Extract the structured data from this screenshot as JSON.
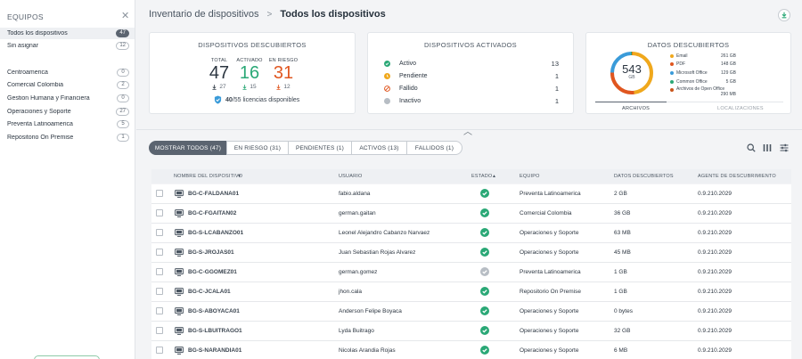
{
  "sidebar": {
    "title": "EQUIPOS",
    "items": [
      {
        "label": "Todos los dispositivos",
        "count": "47",
        "active": true
      },
      {
        "label": "Sin asignar",
        "count": "12"
      },
      {
        "label": "Centroamerica",
        "count": "0"
      },
      {
        "label": "Comercial Colombia",
        "count": "2"
      },
      {
        "label": "Gestion Humana y Financiera",
        "count": "0"
      },
      {
        "label": "Operaciones y Soporte",
        "count": "27"
      },
      {
        "label": "Preventa Latinoamerica",
        "count": "5"
      },
      {
        "label": "Repositorio On Premise",
        "count": "1"
      }
    ]
  },
  "header": {
    "breadcrumb_root": "Inventario de dispositivos",
    "breadcrumb_current": "Todos los dispositivos"
  },
  "discovered": {
    "title": "DISPOSITIVOS DESCUBIERTOS",
    "total_label": "TOTAL",
    "total": "47",
    "total_sub": "27",
    "active_label": "ACTIVADO",
    "active": "16",
    "active_sub": "15",
    "risk_label": "EN RIESGO",
    "risk": "31",
    "risk_sub": "12",
    "licenses_count": "40",
    "licenses_text": "/55 licencias disponibles",
    "colors": {
      "total": "#2b3540",
      "active": "#2aa876",
      "risk": "#e0561f"
    }
  },
  "activated": {
    "title": "DISPOSITIVOS ACTIVADOS",
    "rows": [
      {
        "label": "Activo",
        "count": "13",
        "status": "active",
        "color": "#2aa876"
      },
      {
        "label": "Pendiente",
        "count": "1",
        "status": "pending",
        "color": "#f0a81c"
      },
      {
        "label": "Fallido",
        "count": "1",
        "status": "failed",
        "color": "#e0561f"
      },
      {
        "label": "Inactivo",
        "count": "1",
        "status": "inactive",
        "color": "#b7bdc4"
      }
    ]
  },
  "data_discovered": {
    "title": "DATOS DESCUBIERTOS",
    "total_value": "543",
    "total_unit": "GB",
    "legend": [
      {
        "label": "Email",
        "size": "261 GB",
        "color": "#f0a81c"
      },
      {
        "label": "PDF",
        "size": "148 GB",
        "color": "#e0561f"
      },
      {
        "label": "Microsoft Office",
        "size": "129 GB",
        "color": "#3a9bd9"
      },
      {
        "label": "Common Office",
        "size": "5 GB",
        "color": "#2aa876"
      },
      {
        "label": "Archivos de Open Office",
        "size": "290 MB",
        "color": "#c9551a"
      }
    ],
    "tabs": [
      "ARCHIVOS",
      "LOCALIZACIONES"
    ]
  },
  "filters": [
    {
      "label": "MOSTRAR TODOS (47)"
    },
    {
      "label": "EN RIESGO (31)"
    },
    {
      "label": "PENDIENTES (1)"
    },
    {
      "label": "ACTIVOS (13)"
    },
    {
      "label": "FALLIDOS (1)"
    }
  ],
  "table": {
    "headers": {
      "device": "NOMBRE DEL DISPOSITIVO",
      "user": "USUARIO",
      "status": "ESTADO",
      "team": "EQUIPO",
      "data": "DATOS DESCUBIERTOS",
      "agent": "AGENTE DE DESCUBRIMIENTO"
    },
    "rows": [
      {
        "device": "BG-C-FALDANA01",
        "user": "fabio.aldana",
        "status": "active",
        "team": "Preventa Latinoamerica",
        "data": "2 GB",
        "agent": "0.9.210.2029"
      },
      {
        "device": "BG-C-FGAITAN02",
        "user": "german.gaitan",
        "status": "active",
        "team": "Comercial Colombia",
        "data": "36 GB",
        "agent": "0.9.210.2029"
      },
      {
        "device": "BG-S-LCABANZO01",
        "user": "Leonel Alejandro Cabanzo Narvaez",
        "status": "active",
        "team": "Operaciones y Soporte",
        "data": "63 MB",
        "agent": "0.9.210.2029"
      },
      {
        "device": "BG-S-JROJAS01",
        "user": "Juan Sebastian Rojas Alvarez",
        "status": "active",
        "team": "Operaciones y Soporte",
        "data": "45 MB",
        "agent": "0.9.210.2029"
      },
      {
        "device": "BG-C-GGOMEZ01",
        "user": "german.gomez",
        "status": "inactive",
        "team": "Preventa Latinoamerica",
        "data": "1 GB",
        "agent": "0.9.210.2029"
      },
      {
        "device": "BG-C-JCALA01",
        "user": "jhon.cala",
        "status": "active",
        "team": "Repositorio On Premise",
        "data": "1 GB",
        "agent": "0.9.210.2029"
      },
      {
        "device": "BG-S-ABOYACA01",
        "user": "Anderson Felipe Boyaca",
        "status": "active",
        "team": "Operaciones y Soporte",
        "data": "0 bytes",
        "agent": "0.9.210.2029"
      },
      {
        "device": "BG-S-LBUITRAGO1",
        "user": "Lyda Buitrago",
        "status": "active",
        "team": "Operaciones y Soporte",
        "data": "32 GB",
        "agent": "0.9.210.2029"
      },
      {
        "device": "BG-S-NARANDIA01",
        "user": "Nicolas Arandia Rojas",
        "status": "active",
        "team": "Operaciones y Soporte",
        "data": "6 MB",
        "agent": "0.9.210.2029"
      }
    ]
  }
}
